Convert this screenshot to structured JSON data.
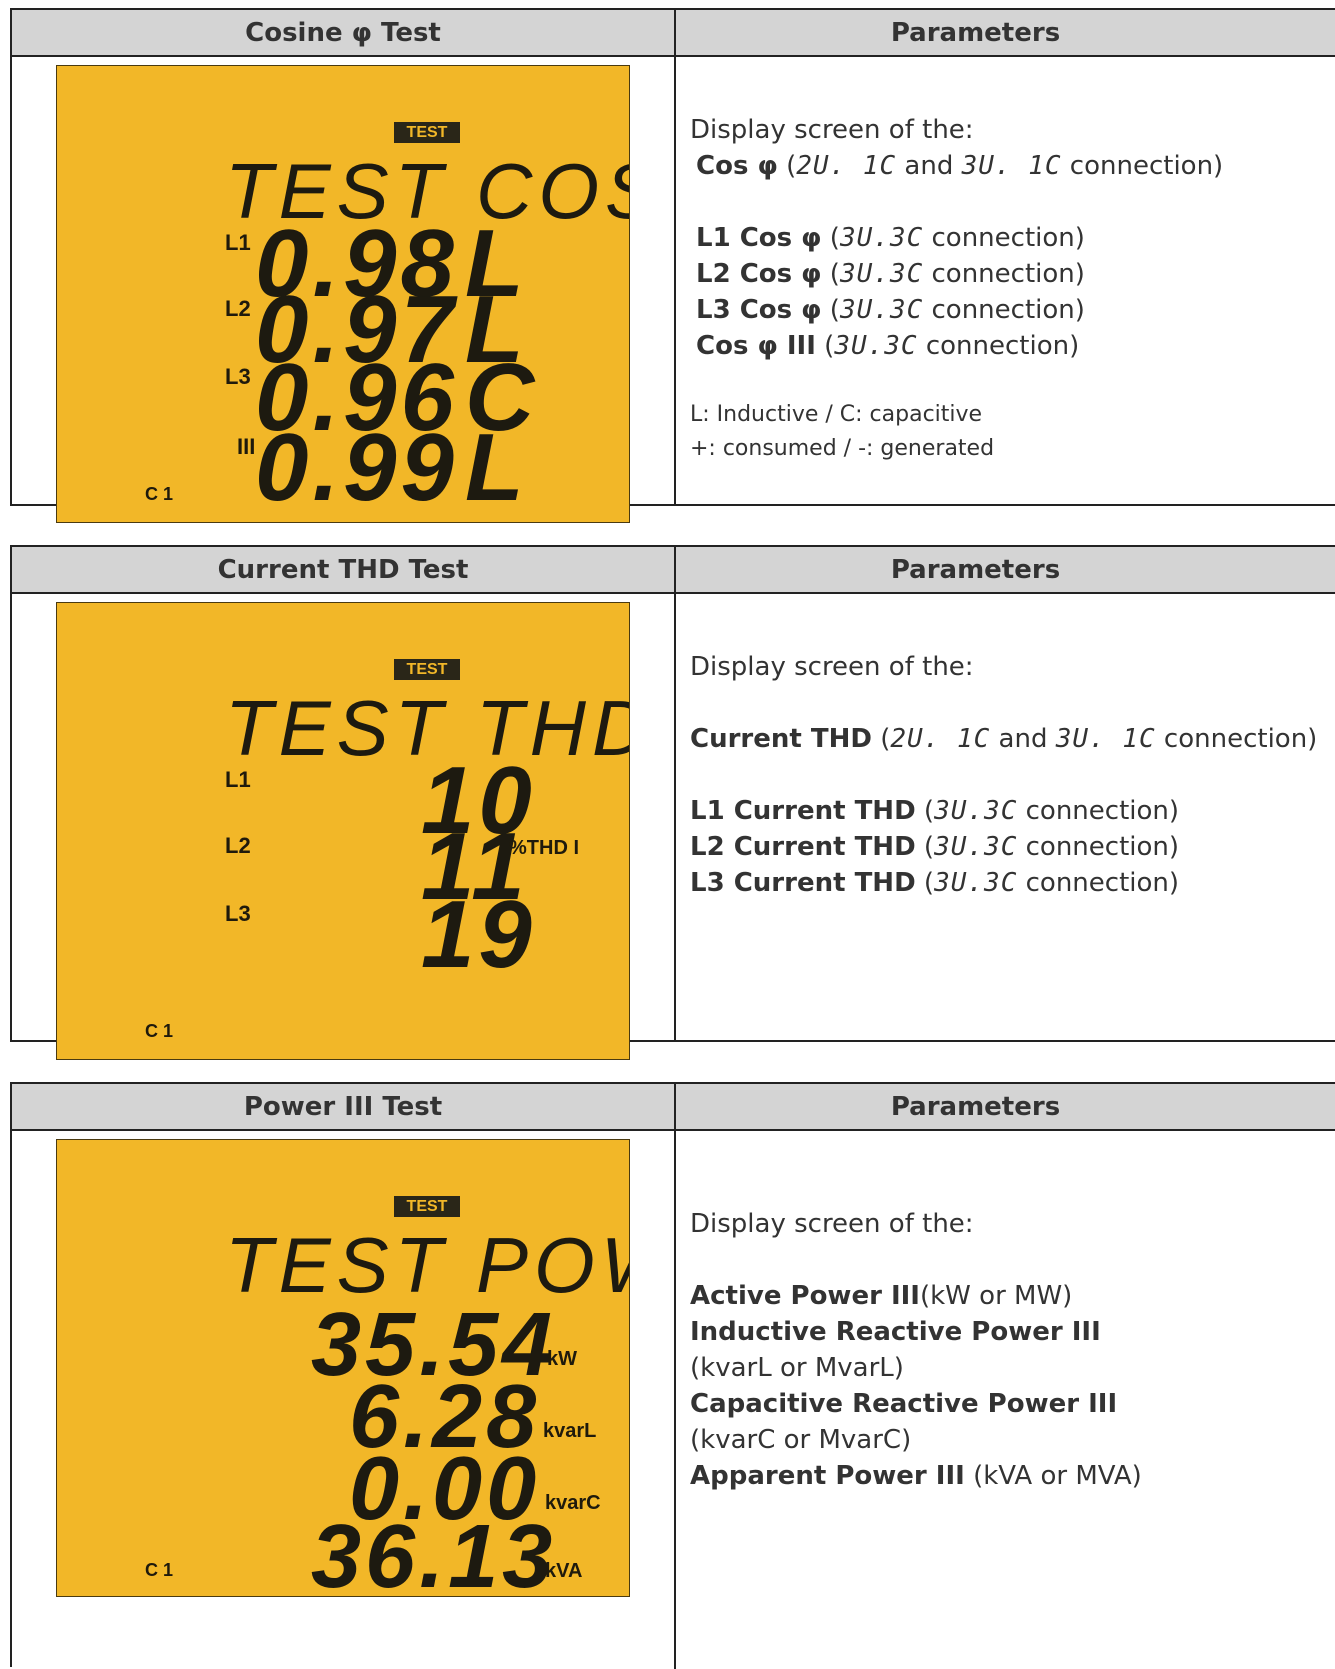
{
  "tables": [
    {
      "header_left": "Cosine φ Test",
      "header_right": "Parameters",
      "lcd": {
        "tag": "TEST",
        "title": "TEST COS",
        "rows": [
          {
            "label": "L1",
            "value": "0.98",
            "unit": "L"
          },
          {
            "label": "L2",
            "value": "0.97",
            "unit": "L"
          },
          {
            "label": "L3",
            "value": "0.96",
            "unit": "C"
          },
          {
            "label": "III",
            "value": "0.99",
            "unit": "L"
          }
        ],
        "channel": "C 1"
      },
      "text": {
        "intro": "Display screen of the:",
        "l0_bold": "Cos φ",
        "l0_a": " (",
        "l0_sg1": "2U. 1C",
        "l0_b": " and ",
        "l0_sg2": "3U. 1C",
        "l0_c": " connection)",
        "items": [
          {
            "bold": "L1 Cos φ",
            "seg": "3U.3C",
            "rest": " connection)"
          },
          {
            "bold": "L2 Cos φ",
            "seg": "3U.3C",
            "rest": " connection)"
          },
          {
            "bold": "L3 Cos φ",
            "seg": "3U.3C",
            "rest": " connection)"
          },
          {
            "bold": "Cos φ III",
            "seg": "3U.3C",
            "rest": " connection)"
          }
        ],
        "note1": "L: Inductive  / C: capacitive",
        "note2": "+: consumed / -: generated"
      }
    },
    {
      "header_left": "Current THD Test",
      "header_right": "Parameters",
      "lcd": {
        "tag": "TEST",
        "title": "TEST THD",
        "rows": [
          {
            "label": "L1",
            "value": "10"
          },
          {
            "label": "L2",
            "value": "11"
          },
          {
            "label": "L3",
            "value": "19"
          }
        ],
        "unit": "%THD  I",
        "channel": "C 1"
      },
      "text": {
        "intro": "Display screen of the:",
        "l0_bold": "Current THD",
        "l0_a": " (",
        "l0_sg1": "2U. 1C",
        "l0_b": " and ",
        "l0_sg2": "3U. 1C",
        "l0_c": " connection)",
        "items": [
          {
            "bold": "L1 Current THD",
            "seg": "3U.3C",
            "rest": " connection)"
          },
          {
            "bold": "L2 Current THD",
            "seg": "3U.3C",
            "rest": " connection)"
          },
          {
            "bold": "L3 Current THD",
            "seg": "3U.3C",
            "rest": " connection)"
          }
        ]
      }
    },
    {
      "header_left": "Power III Test",
      "header_right": "Parameters",
      "lcd": {
        "tag": "TEST",
        "title": "TEST POW",
        "rows": [
          {
            "value": "35.54",
            "unit": "kW"
          },
          {
            "value": "6.28",
            "unit": "kvarL"
          },
          {
            "value": "0.00",
            "unit": "kvarC"
          },
          {
            "value": "36.13",
            "unit": "kVA"
          }
        ],
        "channel": "C 1"
      },
      "text": {
        "intro": "Display screen of the:",
        "b1": "Active Power III",
        "t1": "(kW or MW)",
        "b2": "Inductive Reactive Power III",
        "t2": "(kvarL or MvarL)",
        "b3": "Capacitive Reactive Power III",
        "t3": "(kvarC or MvarC)",
        "b4": "Apparent Power III",
        "t4": " (kVA or MVA)"
      }
    }
  ]
}
